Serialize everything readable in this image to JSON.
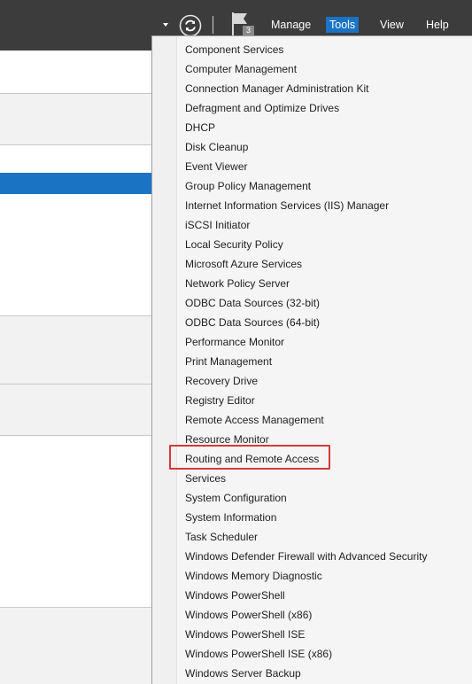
{
  "topbar": {
    "flag_badge": "3",
    "menus": [
      {
        "label": "Manage",
        "active": false
      },
      {
        "label": "Tools",
        "active": true
      },
      {
        "label": "View",
        "active": false
      },
      {
        "label": "Help",
        "active": false
      }
    ],
    "icons": [
      "chevron-down-icon",
      "refresh-icon",
      "flag-icon"
    ]
  },
  "colors": {
    "topbar_bg": "#3c3c3c",
    "accent": "#1a73c3",
    "highlight": "#d33a3a"
  },
  "tools_menu": {
    "items": [
      "Component Services",
      "Computer Management",
      "Connection Manager Administration Kit",
      "Defragment and Optimize Drives",
      "DHCP",
      "Disk Cleanup",
      "Event Viewer",
      "Group Policy Management",
      "Internet Information Services (IIS) Manager",
      "iSCSI Initiator",
      "Local Security Policy",
      "Microsoft Azure Services",
      "Network Policy Server",
      "ODBC Data Sources (32-bit)",
      "ODBC Data Sources (64-bit)",
      "Performance Monitor",
      "Print Management",
      "Recovery Drive",
      "Registry Editor",
      "Remote Access Management",
      "Resource Monitor",
      "Routing and Remote Access",
      "Services",
      "System Configuration",
      "System Information",
      "Task Scheduler",
      "Windows Defender Firewall with Advanced Security",
      "Windows Memory Diagnostic",
      "Windows PowerShell",
      "Windows PowerShell (x86)",
      "Windows PowerShell ISE",
      "Windows PowerShell ISE (x86)",
      "Windows Server Backup"
    ],
    "highlighted": "Routing and Remote Access"
  }
}
